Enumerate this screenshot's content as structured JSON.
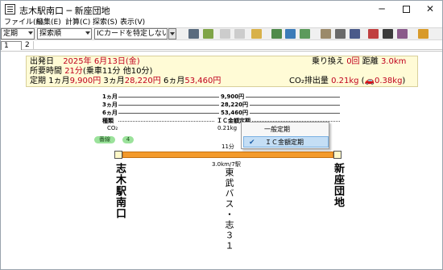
{
  "window": {
    "title": "志木駅南口 ─ 新座団地",
    "minimize": "─",
    "close": "✕"
  },
  "menu": [
    {
      "label": "ファイル(F)"
    },
    {
      "label": "編集(E)"
    },
    {
      "label": "計算(C)"
    },
    {
      "label": "探索(S)"
    },
    {
      "label": "表示(V)"
    }
  ],
  "toolbar": {
    "ticket_type": "定期",
    "sort_order": "探索順",
    "ic_card": "ICカードを特定しない"
  },
  "tabs": [
    "1",
    "2"
  ],
  "summary": {
    "departure_label": "出発日",
    "departure_date": "2025年 6月13日(金)",
    "time_label": "所要時間",
    "time_value": "21分",
    "time_detail": "(乗車11分 他10分)",
    "pass_label": "定期",
    "pass_1m_label": "1ヵ月",
    "pass_1m": "9,900円",
    "pass_3m_label": "3ヵ月",
    "pass_3m": "28,220円",
    "pass_6m_label": "6ヵ月",
    "pass_6m": "53,460円",
    "transfer_label": "乗り換え",
    "transfer_value": "0回",
    "distance_label": "距離",
    "distance_value": "3.0km",
    "co2_label": "CO₂排出量",
    "co2_value": "0.21kg",
    "co2_car": "0.38kg"
  },
  "fares": [
    {
      "label": "1ヵ月",
      "value": "9,900円"
    },
    {
      "label": "3ヵ月",
      "value": "28,220円"
    },
    {
      "label": "6ヵ月",
      "value": "53,460円"
    },
    {
      "label": "種類",
      "value": "ＩＣ金額定期"
    }
  ],
  "co2_row": {
    "label": "CO₂",
    "value": "0.21kg"
  },
  "tags": {
    "line_no_label": "番線",
    "line_no": "4"
  },
  "route": {
    "from": "志木駅南口",
    "to": "新座団地",
    "minutes": "11分",
    "distance": "3.0km/7駅",
    "line": "東武バス・志３１"
  },
  "popup": {
    "items": [
      "一般定期",
      "ＩＣ金額定期"
    ],
    "selected_index": 1
  },
  "colors": {
    "accent_red": "#c0001d",
    "summary_bg": "#fffbd6",
    "route_bar": "#f39a2b",
    "tag_green": "#9be29b",
    "menu_highlight": "#c4def5"
  }
}
